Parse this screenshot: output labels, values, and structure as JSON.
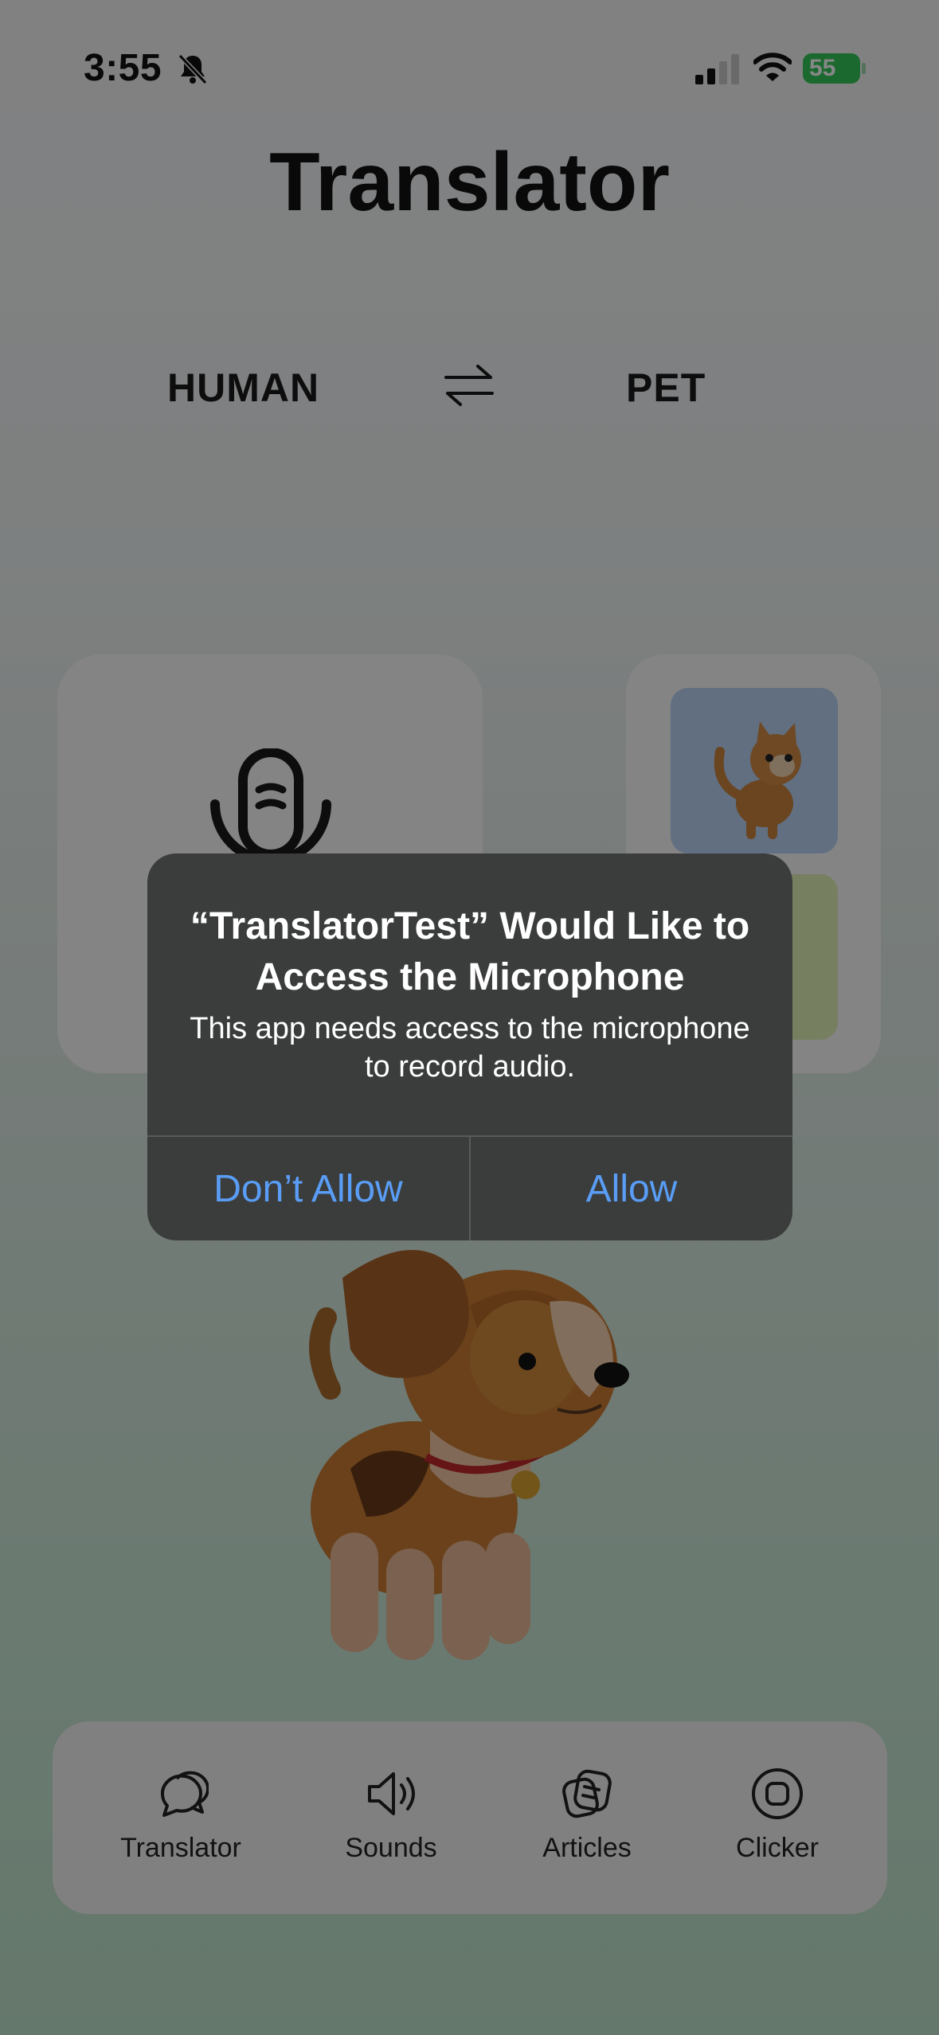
{
  "status_bar": {
    "time": "3:55",
    "battery": "55",
    "icons": [
      "bell-slash-icon",
      "cellular-signal-icon",
      "wifi-icon",
      "battery-charging-icon"
    ]
  },
  "header": {
    "title": "Translator"
  },
  "language_switch": {
    "from": "HUMAN",
    "to": "PET",
    "icon": "swap-arrows-icon"
  },
  "cards": {
    "left_icon": "microphone-icon",
    "right_tiles": [
      "cat-image",
      "green-tile"
    ]
  },
  "alert": {
    "title": "“TranslatorTest” Would Like to Access the Microphone",
    "message": "This app needs access to the microphone to record audio.",
    "deny_label": "Don’t Allow",
    "allow_label": "Allow"
  },
  "tab_bar": {
    "items": [
      {
        "label": "Translator",
        "icon": "chat-bubbles-icon"
      },
      {
        "label": "Sounds",
        "icon": "speaker-icon"
      },
      {
        "label": "Articles",
        "icon": "articles-icon"
      },
      {
        "label": "Clicker",
        "icon": "clicker-icon"
      }
    ]
  },
  "colors": {
    "alert_bg": "#3a3d3c",
    "alert_button": "#5a9df6",
    "battery_green": "#34c759"
  }
}
